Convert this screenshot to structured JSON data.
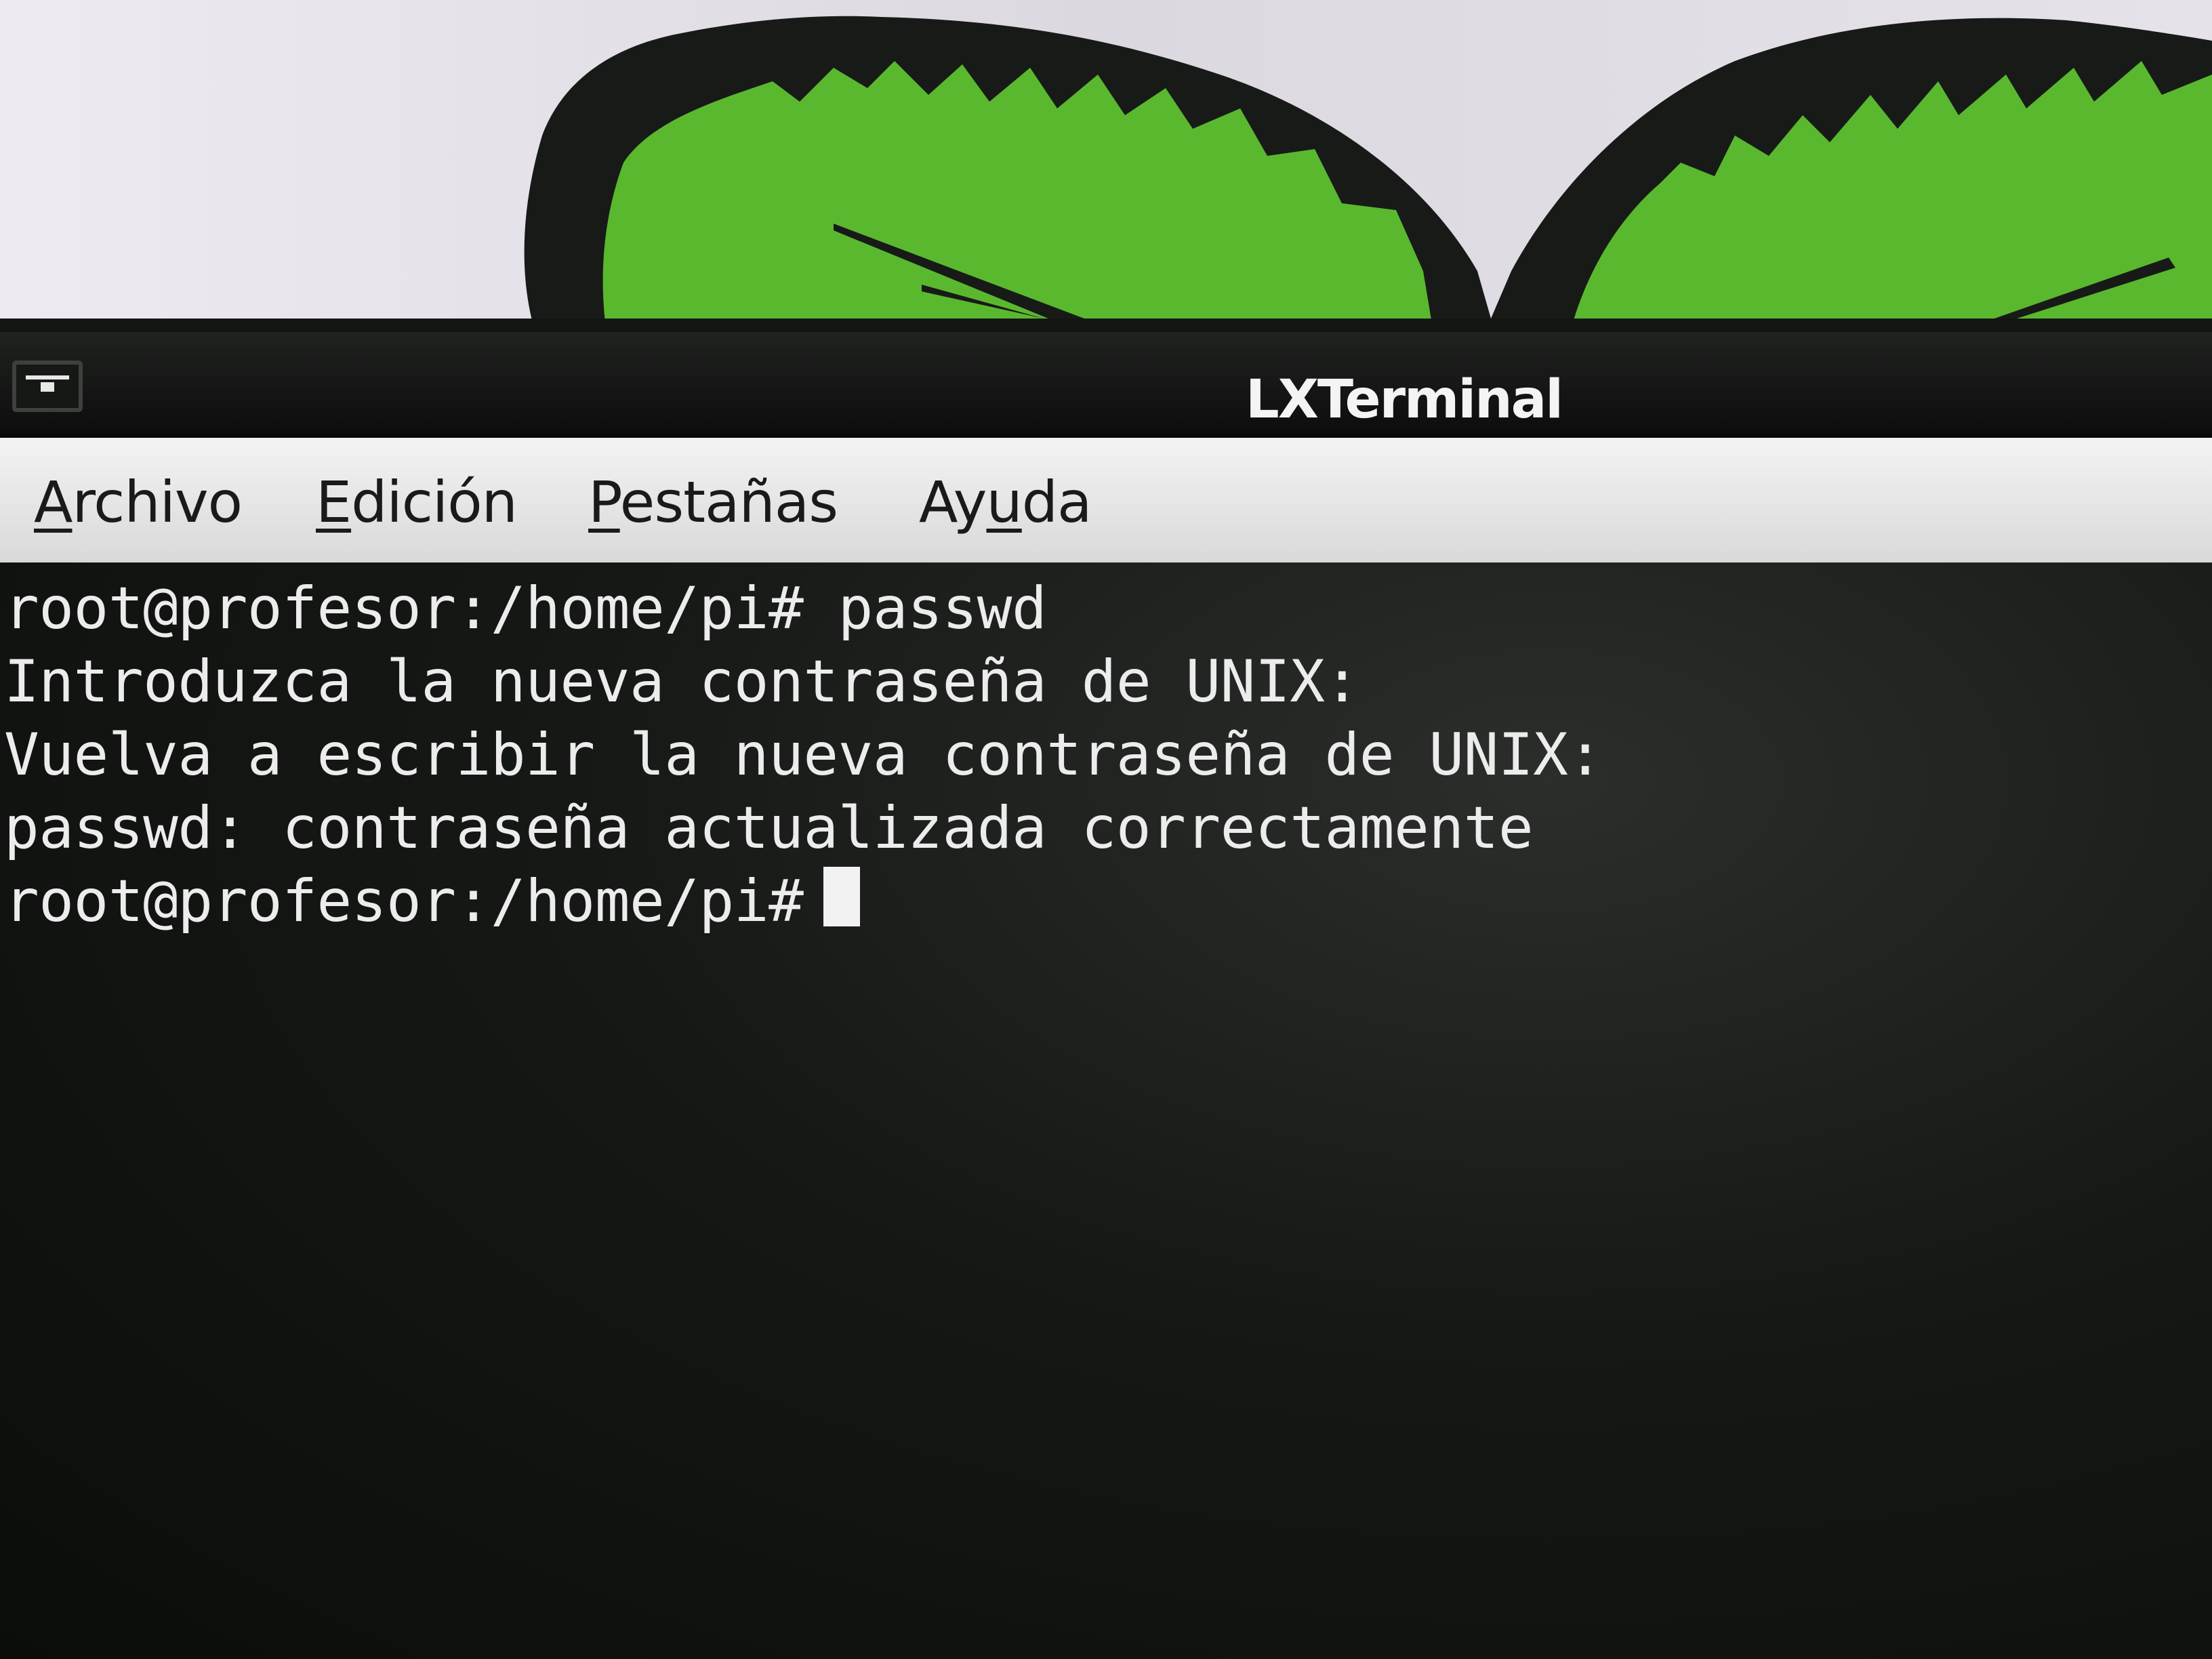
{
  "wallpaper": {
    "description_icon": "raspberry-leaves-logo",
    "colors": {
      "leaf_green": "#5ab82f",
      "leaf_dark": "#1a1c1a",
      "sky": "#e8e4ec"
    }
  },
  "window": {
    "title": "LXTerminal",
    "menu_icon": "window-menu-icon"
  },
  "menubar": {
    "items": [
      {
        "mnemonic": "A",
        "rest": "rchivo"
      },
      {
        "mnemonic": "E",
        "rest": "dición"
      },
      {
        "mnemonic": "P",
        "rest": "estañas"
      },
      {
        "prefix": "Ay",
        "mnemonic": "u",
        "rest": "da"
      }
    ]
  },
  "terminal": {
    "lines": [
      "root@profesor:/home/pi# passwd",
      "Introduzca la nueva contraseña de UNIX:",
      "Vuelva a escribir la nueva contraseña de UNIX:",
      "passwd: contraseña actualizada correctamente"
    ],
    "prompt": "root@profesor:/home/pi#",
    "text_color": "#ececec",
    "background": "#151815"
  }
}
